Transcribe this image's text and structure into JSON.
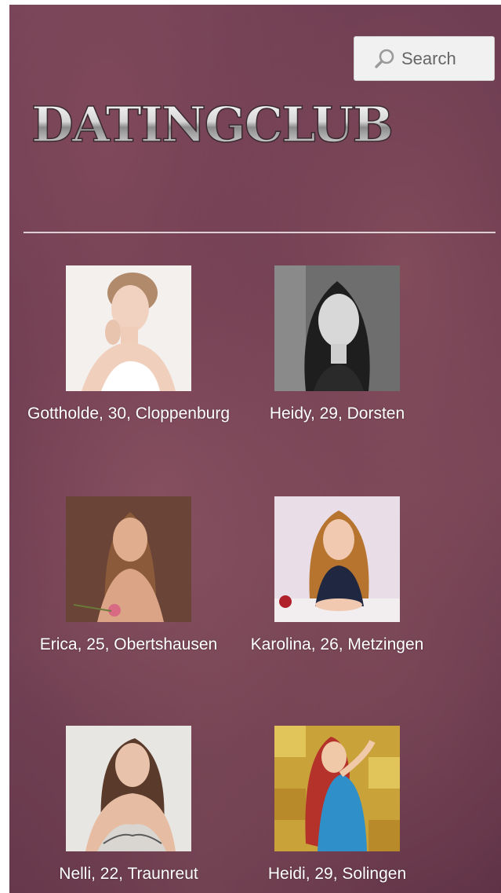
{
  "search": {
    "placeholder": "Search"
  },
  "logo": {
    "text": "DATINGCLUB"
  },
  "profiles": [
    {
      "caption": "Gottholde, 30, Cloppenburg",
      "photo": "woman-portrait-white-top"
    },
    {
      "caption": "Heidy, 29, Dorsten",
      "photo": "woman-portrait-bw"
    },
    {
      "caption": "Erica, 25, Obertshausen",
      "photo": "woman-portrait-rose"
    },
    {
      "caption": "Karolina, 26, Metzingen",
      "photo": "woman-portrait-table"
    },
    {
      "caption": "Nelli, 22, Traunreut",
      "photo": "woman-portrait-lace"
    },
    {
      "caption": "Heidi, 29, Solingen",
      "photo": "woman-portrait-blue-dress"
    }
  ],
  "colors": {
    "background_tint": "#6a3b50",
    "caption_text": "#ffffff",
    "search_bg": "#f1f1f1"
  }
}
